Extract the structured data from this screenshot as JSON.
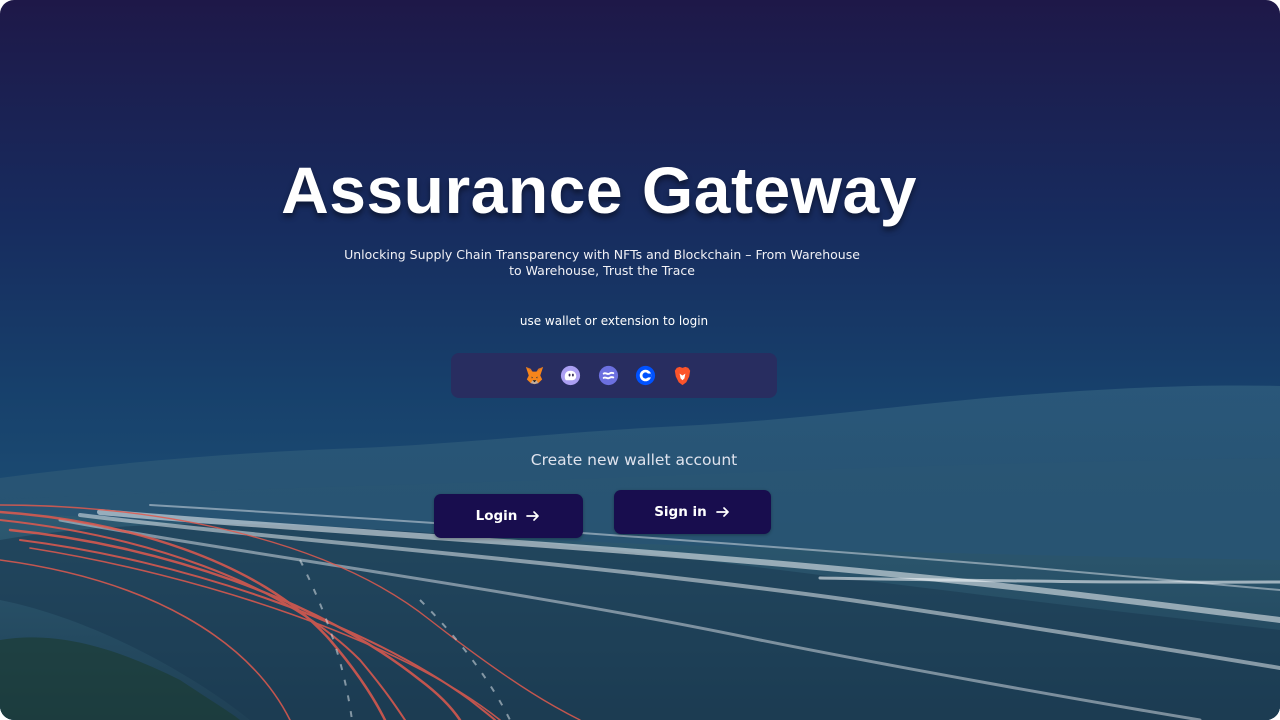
{
  "hero": {
    "title": "Assurance Gateway",
    "subtitle": "Unlocking Supply Chain Transparency with NFTs and Blockchain – From Warehouse to Warehouse, Trust the Trace"
  },
  "wallet_login": {
    "hint": "use wallet or extension to login",
    "wallets": [
      {
        "icon": "metamask-fox-icon"
      },
      {
        "icon": "phantom-ghost-icon"
      },
      {
        "icon": "solflare-icon"
      },
      {
        "icon": "coinbase-icon"
      },
      {
        "icon": "brave-lion-icon"
      }
    ]
  },
  "actions": {
    "create_account": "Create new wallet account",
    "login_label": "Login",
    "signin_label": "Sign in"
  },
  "colors": {
    "button_bg": "#180d4e",
    "wallet_bar_bg": "#2c2a5e",
    "light_trail": "#e05a4e"
  }
}
